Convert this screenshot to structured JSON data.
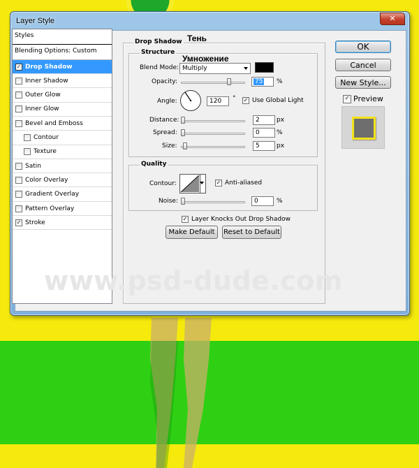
{
  "dialog": {
    "title": "Layer Style",
    "close_glyph": "✕"
  },
  "styles_panel": {
    "header": "Styles",
    "blending_options": "Blending Options: Custom",
    "items": [
      {
        "label": "Drop Shadow",
        "checked": true,
        "selected": true
      },
      {
        "label": "Inner Shadow",
        "checked": false
      },
      {
        "label": "Outer Glow",
        "checked": false
      },
      {
        "label": "Inner Glow",
        "checked": false
      },
      {
        "label": "Bevel and Emboss",
        "checked": false
      },
      {
        "label": "Contour",
        "checked": false,
        "indent": true
      },
      {
        "label": "Texture",
        "checked": false,
        "indent": true
      },
      {
        "label": "Satin",
        "checked": false
      },
      {
        "label": "Color Overlay",
        "checked": false
      },
      {
        "label": "Gradient Overlay",
        "checked": false
      },
      {
        "label": "Pattern Overlay",
        "checked": false
      },
      {
        "label": "Stroke",
        "checked": true
      }
    ]
  },
  "drop_shadow": {
    "title": "Drop Shadow",
    "annotation_title": "Тень",
    "annotation_blend": "Умножение",
    "structure": {
      "title": "Structure",
      "blend_mode_label": "Blend Mode:",
      "blend_mode_value": "Multiply",
      "shadow_color": "#000000",
      "opacity_label": "Opacity:",
      "opacity_value": "75",
      "opacity_fraction": 0.75,
      "angle_label": "Angle:",
      "angle_value": "120",
      "degree_symbol": "°",
      "use_global_light_label": "Use Global Light",
      "use_global_light_checked": true,
      "distance_label": "Distance:",
      "distance_value": "2",
      "spread_label": "Spread:",
      "spread_value": "0",
      "size_label": "Size:",
      "size_value": "5",
      "px_unit": "px",
      "percent_unit": "%"
    },
    "quality": {
      "title": "Quality",
      "contour_label": "Contour:",
      "anti_aliased_label": "Anti-aliased",
      "anti_aliased_checked": true,
      "noise_label": "Noise:",
      "noise_value": "0",
      "percent_unit": "%"
    },
    "layer_knocks_out_label": "Layer Knocks Out Drop Shadow",
    "layer_knocks_out_checked": true,
    "make_default_label": "Make Default",
    "reset_default_label": "Reset to Default"
  },
  "buttons": {
    "ok": "OK",
    "cancel": "Cancel",
    "new_style": "New Style...",
    "preview_label": "Preview",
    "preview_checked": true
  },
  "watermark": "www.psd-dude.com",
  "colors": {
    "accent": "#3399ff",
    "background_yellow": "#f5ea0c",
    "background_green": "#2fd013",
    "preview_swatch": "#6e6e6e",
    "preview_border": "#f2e31a"
  }
}
